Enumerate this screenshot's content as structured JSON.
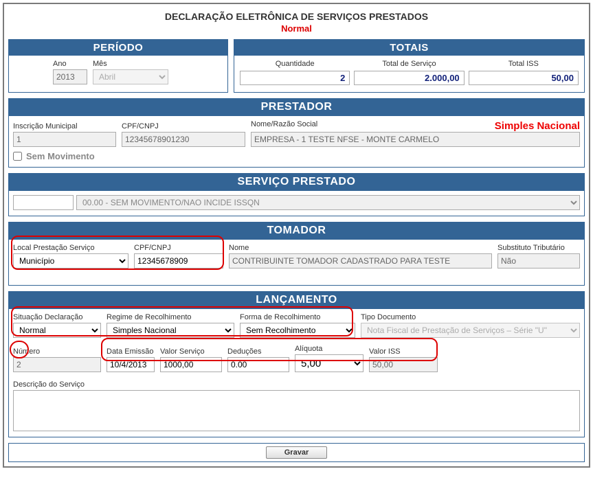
{
  "header": {
    "title": "DECLARAÇÃO ELETRÔNICA DE SERVIÇOS PRESTADOS",
    "subtitle": "Normal"
  },
  "periodo": {
    "title": "PERÍODO",
    "ano_label": "Ano",
    "ano_value": "2013",
    "mes_label": "Mês",
    "mes_value": "Abril"
  },
  "totais": {
    "title": "TOTAIS",
    "quantidade_label": "Quantidade",
    "quantidade_value": "2",
    "total_servico_label": "Total de Serviço",
    "total_servico_value": "2.000,00",
    "total_iss_label": "Total ISS",
    "total_iss_value": "50,00"
  },
  "prestador": {
    "title": "PRESTADOR",
    "inscricao_label": "Inscrição Municipal",
    "inscricao_value": "1",
    "cpf_label": "CPF/CNPJ",
    "cpf_value": "12345678901230",
    "nome_label": "Nome/Razão Social",
    "nome_value": "EMPRESA - 1 TESTE NFSE - MONTE CARMELO",
    "simples_badge": "Simples Nacional",
    "sem_movimento_label": "Sem Movimento"
  },
  "servico": {
    "title": "SERVIÇO PRESTADO",
    "codigo_value": "",
    "descricao_value": "00.00 - SEM MOVIMENTO/NAO INCIDE ISSQN"
  },
  "tomador": {
    "title": "TOMADOR",
    "local_label": "Local Prestação Serviço",
    "local_value": "Município",
    "cpf_label": "CPF/CNPJ",
    "cpf_value": "12345678909",
    "nome_label": "Nome",
    "nome_value": "CONTRIBUINTE TOMADOR CADASTRADO PARA TESTE",
    "substituto_label": "Substituto Tributário",
    "substituto_value": "Não"
  },
  "lancamento": {
    "title": "LANÇAMENTO",
    "situacao_label": "Situação Declaração",
    "situacao_value": "Normal",
    "regime_label": "Regime de Recolhimento",
    "regime_value": "Simples Nacional",
    "forma_label": "Forma de Recolhimento",
    "forma_value": "Sem Recolhimento",
    "tipo_label": "Tipo Documento",
    "tipo_value": "Nota Fiscal de Prestação de Serviços – Série \"U\"",
    "numero_label": "Número",
    "numero_value": "2",
    "data_label": "Data Emissão",
    "data_value": "10/4/2013",
    "valor_servico_label": "Valor Serviço",
    "valor_servico_value": "1000,00",
    "deducoes_label": "Deduções",
    "deducoes_value": "0.00",
    "aliquota_label": "Alíquota",
    "aliquota_value": "5,00",
    "valor_iss_label": "Valor ISS",
    "valor_iss_value": "50,00",
    "descricao_label": "Descrição do Serviço",
    "descricao_value": ""
  },
  "actions": {
    "gravar_label": "Gravar"
  }
}
